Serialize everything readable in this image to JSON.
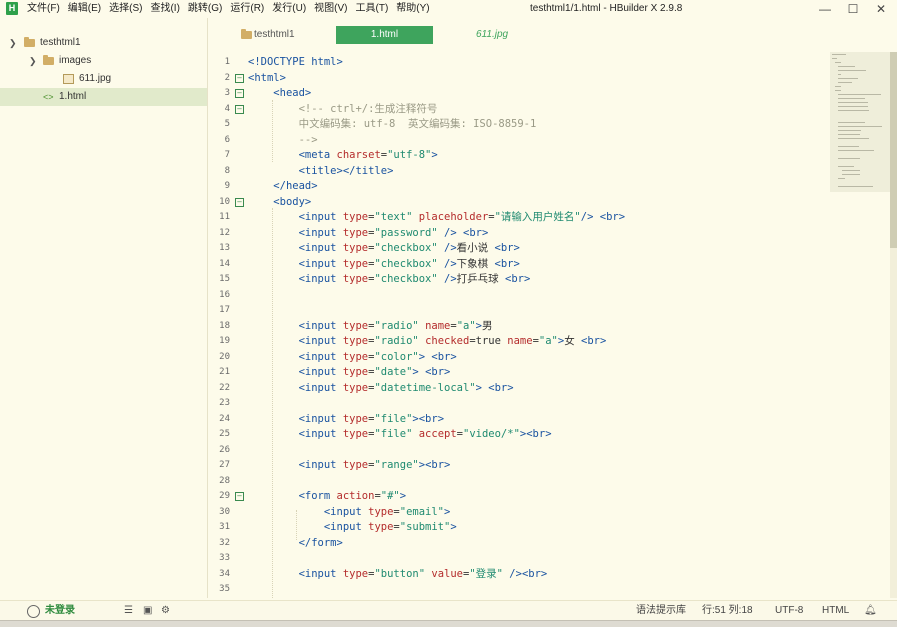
{
  "app": {
    "logo_letter": "H",
    "window_title": "testhtml1/1.html - HBuilder X 2.9.8"
  },
  "menu": [
    "文件(F)",
    "编辑(E)",
    "选择(S)",
    "查找(I)",
    "跳转(G)",
    "运行(R)",
    "发行(U)",
    "视图(V)",
    "工具(T)",
    "帮助(Y)"
  ],
  "window_buttons": {
    "minimize": "—",
    "maximize": "☐",
    "close": "✕"
  },
  "sidebar": {
    "project": "testhtml1",
    "folder": "images",
    "image_file": "611.jpg",
    "html_file": "1.html"
  },
  "tabs": {
    "project": "testhtml1",
    "active": "1.html",
    "image": "611.jpg"
  },
  "code_lines": [
    {
      "n": "1",
      "fold": "",
      "parts": [
        [
          "t",
          "<!DOCTYPE html>"
        ]
      ]
    },
    {
      "n": "2",
      "fold": "−",
      "parts": [
        [
          "t",
          "<html>"
        ]
      ]
    },
    {
      "n": "3",
      "fold": "−",
      "parts": [
        [
          "p",
          "    "
        ],
        [
          "t",
          "<head>"
        ]
      ]
    },
    {
      "n": "4",
      "fold": "−",
      "parts": [
        [
          "p",
          "        "
        ],
        [
          "c",
          "<!-- ctrl+/:生成注释符号"
        ]
      ]
    },
    {
      "n": "5",
      "fold": "",
      "parts": [
        [
          "p",
          "        "
        ],
        [
          "c",
          "中文编码集: utf-8  英文编码集: ISO-8859-1"
        ]
      ]
    },
    {
      "n": "6",
      "fold": "",
      "parts": [
        [
          "p",
          "        "
        ],
        [
          "c",
          "-->"
        ]
      ]
    },
    {
      "n": "7",
      "fold": "",
      "parts": [
        [
          "p",
          "        "
        ],
        [
          "t",
          "<meta "
        ],
        [
          "a",
          "charset"
        ],
        [
          "p",
          "="
        ],
        [
          "s",
          "\"utf-8\""
        ],
        [
          "t",
          ">"
        ]
      ]
    },
    {
      "n": "8",
      "fold": "",
      "parts": [
        [
          "p",
          "        "
        ],
        [
          "t",
          "<title></title>"
        ]
      ]
    },
    {
      "n": "9",
      "fold": "",
      "parts": [
        [
          "p",
          "    "
        ],
        [
          "t",
          "</head>"
        ]
      ]
    },
    {
      "n": "10",
      "fold": "−",
      "parts": [
        [
          "p",
          "    "
        ],
        [
          "t",
          "<body>"
        ]
      ]
    },
    {
      "n": "11",
      "fold": "",
      "parts": [
        [
          "p",
          "        "
        ],
        [
          "t",
          "<input "
        ],
        [
          "a",
          "type"
        ],
        [
          "p",
          "="
        ],
        [
          "s",
          "\"text\""
        ],
        [
          "p",
          " "
        ],
        [
          "a",
          "placeholder"
        ],
        [
          "p",
          "="
        ],
        [
          "s",
          "\"请输入用户姓名\""
        ],
        [
          "t",
          "/>"
        ],
        [
          "p",
          " "
        ],
        [
          "t",
          "<br>"
        ]
      ]
    },
    {
      "n": "12",
      "fold": "",
      "parts": [
        [
          "p",
          "        "
        ],
        [
          "t",
          "<input "
        ],
        [
          "a",
          "type"
        ],
        [
          "p",
          "="
        ],
        [
          "s",
          "\"password\""
        ],
        [
          "p",
          " "
        ],
        [
          "t",
          "/>"
        ],
        [
          "p",
          " "
        ],
        [
          "t",
          "<br>"
        ]
      ]
    },
    {
      "n": "13",
      "fold": "",
      "parts": [
        [
          "p",
          "        "
        ],
        [
          "t",
          "<input "
        ],
        [
          "a",
          "type"
        ],
        [
          "p",
          "="
        ],
        [
          "s",
          "\"checkbox\""
        ],
        [
          "p",
          " "
        ],
        [
          "t",
          "/>"
        ],
        [
          "p",
          "看小说 "
        ],
        [
          "t",
          "<br>"
        ]
      ]
    },
    {
      "n": "14",
      "fold": "",
      "parts": [
        [
          "p",
          "        "
        ],
        [
          "t",
          "<input "
        ],
        [
          "a",
          "type"
        ],
        [
          "p",
          "="
        ],
        [
          "s",
          "\"checkbox\""
        ],
        [
          "p",
          " "
        ],
        [
          "t",
          "/>"
        ],
        [
          "p",
          "下象棋 "
        ],
        [
          "t",
          "<br>"
        ]
      ]
    },
    {
      "n": "15",
      "fold": "",
      "parts": [
        [
          "p",
          "        "
        ],
        [
          "t",
          "<input "
        ],
        [
          "a",
          "type"
        ],
        [
          "p",
          "="
        ],
        [
          "s",
          "\"checkbox\""
        ],
        [
          "p",
          " "
        ],
        [
          "t",
          "/>"
        ],
        [
          "p",
          "打乒乓球 "
        ],
        [
          "t",
          "<br>"
        ]
      ]
    },
    {
      "n": "16",
      "fold": "",
      "parts": []
    },
    {
      "n": "17",
      "fold": "",
      "parts": []
    },
    {
      "n": "18",
      "fold": "",
      "parts": [
        [
          "p",
          "        "
        ],
        [
          "t",
          "<input "
        ],
        [
          "a",
          "type"
        ],
        [
          "p",
          "="
        ],
        [
          "s",
          "\"radio\""
        ],
        [
          "p",
          " "
        ],
        [
          "a",
          "name"
        ],
        [
          "p",
          "="
        ],
        [
          "s",
          "\"a\""
        ],
        [
          "t",
          ">"
        ],
        [
          "p",
          "男"
        ]
      ]
    },
    {
      "n": "19",
      "fold": "",
      "parts": [
        [
          "p",
          "        "
        ],
        [
          "t",
          "<input "
        ],
        [
          "a",
          "type"
        ],
        [
          "p",
          "="
        ],
        [
          "s",
          "\"radio\""
        ],
        [
          "p",
          " "
        ],
        [
          "a",
          "checked"
        ],
        [
          "p",
          "=true "
        ],
        [
          "a",
          "name"
        ],
        [
          "p",
          "="
        ],
        [
          "s",
          "\"a\""
        ],
        [
          "t",
          ">"
        ],
        [
          "p",
          "女 "
        ],
        [
          "t",
          "<br>"
        ]
      ]
    },
    {
      "n": "20",
      "fold": "",
      "parts": [
        [
          "p",
          "        "
        ],
        [
          "t",
          "<input "
        ],
        [
          "a",
          "type"
        ],
        [
          "p",
          "="
        ],
        [
          "s",
          "\"color\""
        ],
        [
          "t",
          ">"
        ],
        [
          "p",
          " "
        ],
        [
          "t",
          "<br>"
        ]
      ]
    },
    {
      "n": "21",
      "fold": "",
      "parts": [
        [
          "p",
          "        "
        ],
        [
          "t",
          "<input "
        ],
        [
          "a",
          "type"
        ],
        [
          "p",
          "="
        ],
        [
          "s",
          "\"date\""
        ],
        [
          "t",
          ">"
        ],
        [
          "p",
          " "
        ],
        [
          "t",
          "<br>"
        ]
      ]
    },
    {
      "n": "22",
      "fold": "",
      "parts": [
        [
          "p",
          "        "
        ],
        [
          "t",
          "<input "
        ],
        [
          "a",
          "type"
        ],
        [
          "p",
          "="
        ],
        [
          "s",
          "\"datetime-local\""
        ],
        [
          "t",
          ">"
        ],
        [
          "p",
          " "
        ],
        [
          "t",
          "<br>"
        ]
      ]
    },
    {
      "n": "23",
      "fold": "",
      "parts": []
    },
    {
      "n": "24",
      "fold": "",
      "parts": [
        [
          "p",
          "        "
        ],
        [
          "t",
          "<input "
        ],
        [
          "a",
          "type"
        ],
        [
          "p",
          "="
        ],
        [
          "s",
          "\"file\""
        ],
        [
          "t",
          ">"
        ],
        [
          "t",
          "<br>"
        ]
      ]
    },
    {
      "n": "25",
      "fold": "",
      "parts": [
        [
          "p",
          "        "
        ],
        [
          "t",
          "<input "
        ],
        [
          "a",
          "type"
        ],
        [
          "p",
          "="
        ],
        [
          "s",
          "\"file\""
        ],
        [
          "p",
          " "
        ],
        [
          "a",
          "accept"
        ],
        [
          "p",
          "="
        ],
        [
          "s",
          "\"video/*\""
        ],
        [
          "t",
          ">"
        ],
        [
          "t",
          "<br>"
        ]
      ]
    },
    {
      "n": "26",
      "fold": "",
      "parts": []
    },
    {
      "n": "27",
      "fold": "",
      "parts": [
        [
          "p",
          "        "
        ],
        [
          "t",
          "<input "
        ],
        [
          "a",
          "type"
        ],
        [
          "p",
          "="
        ],
        [
          "s",
          "\"range\""
        ],
        [
          "t",
          ">"
        ],
        [
          "t",
          "<br>"
        ]
      ]
    },
    {
      "n": "28",
      "fold": "",
      "parts": []
    },
    {
      "n": "29",
      "fold": "−",
      "parts": [
        [
          "p",
          "        "
        ],
        [
          "t",
          "<form "
        ],
        [
          "a",
          "action"
        ],
        [
          "p",
          "="
        ],
        [
          "s",
          "\"#\""
        ],
        [
          "t",
          ">"
        ]
      ]
    },
    {
      "n": "30",
      "fold": "",
      "parts": [
        [
          "p",
          "            "
        ],
        [
          "t",
          "<input "
        ],
        [
          "a",
          "type"
        ],
        [
          "p",
          "="
        ],
        [
          "s",
          "\"email\""
        ],
        [
          "t",
          ">"
        ]
      ]
    },
    {
      "n": "31",
      "fold": "",
      "parts": [
        [
          "p",
          "            "
        ],
        [
          "t",
          "<input "
        ],
        [
          "a",
          "type"
        ],
        [
          "p",
          "="
        ],
        [
          "s",
          "\"submit\""
        ],
        [
          "t",
          ">"
        ]
      ]
    },
    {
      "n": "32",
      "fold": "",
      "parts": [
        [
          "p",
          "        "
        ],
        [
          "t",
          "</form>"
        ]
      ]
    },
    {
      "n": "33",
      "fold": "",
      "parts": []
    },
    {
      "n": "34",
      "fold": "",
      "parts": [
        [
          "p",
          "        "
        ],
        [
          "t",
          "<input "
        ],
        [
          "a",
          "type"
        ],
        [
          "p",
          "="
        ],
        [
          "s",
          "\"button\""
        ],
        [
          "p",
          " "
        ],
        [
          "a",
          "value"
        ],
        [
          "p",
          "="
        ],
        [
          "s",
          "\"登录\""
        ],
        [
          "p",
          " "
        ],
        [
          "t",
          "/>"
        ],
        [
          "t",
          "<br>"
        ]
      ]
    },
    {
      "n": "35",
      "fold": "",
      "parts": []
    }
  ],
  "status": {
    "login": "未登录",
    "hint": "语法提示库",
    "position": "行:51  列:18",
    "encoding": "UTF-8",
    "language": "HTML"
  },
  "colors": {
    "accent": "#3ea45d",
    "background": "#fdfbea",
    "tag": "#1a53a0",
    "attribute": "#b42c2c",
    "string": "#1f8a70",
    "comment": "#9a9a86"
  }
}
